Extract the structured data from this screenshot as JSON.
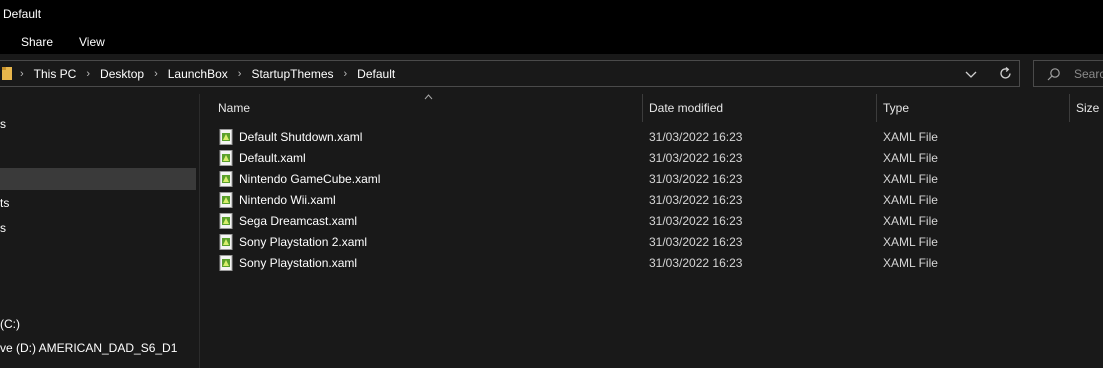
{
  "window": {
    "title": "Default"
  },
  "ribbon": {
    "tabs": [
      "Share",
      "View"
    ]
  },
  "address": {
    "crumbs": [
      "This PC",
      "Desktop",
      "LaunchBox",
      "StartupThemes",
      "Default"
    ],
    "search_placeholder": "Search Default"
  },
  "nav": {
    "items": [
      "s",
      "",
      "ts",
      "s",
      "(C:)",
      "ve (D:) AMERICAN_DAD_S6_D1"
    ]
  },
  "columns": {
    "name": "Name",
    "date": "Date modified",
    "type": "Type",
    "size": "Size"
  },
  "files": [
    {
      "name": "Default Shutdown.xaml",
      "date": "31/03/2022 16:23",
      "type": "XAML File"
    },
    {
      "name": "Default.xaml",
      "date": "31/03/2022 16:23",
      "type": "XAML File"
    },
    {
      "name": "Nintendo GameCube.xaml",
      "date": "31/03/2022 16:23",
      "type": "XAML File"
    },
    {
      "name": "Nintendo Wii.xaml",
      "date": "31/03/2022 16:23",
      "type": "XAML File"
    },
    {
      "name": "Sega Dreamcast.xaml",
      "date": "31/03/2022 16:23",
      "type": "XAML File"
    },
    {
      "name": "Sony Playstation 2.xaml",
      "date": "31/03/2022 16:23",
      "type": "XAML File"
    },
    {
      "name": "Sony Playstation.xaml",
      "date": "31/03/2022 16:23",
      "type": "XAML File"
    }
  ],
  "colors": {
    "background": "#191919",
    "titlebar": "#000000",
    "selection": "#3a3a3a",
    "folder": "#e8b64c"
  },
  "icons": {
    "folder": "folder-icon",
    "chevron": "chevron-right-icon",
    "dropdown": "chevron-down-icon",
    "refresh": "refresh-icon",
    "search": "search-icon",
    "file": "xaml-file-icon",
    "sort": "sort-up-icon"
  }
}
